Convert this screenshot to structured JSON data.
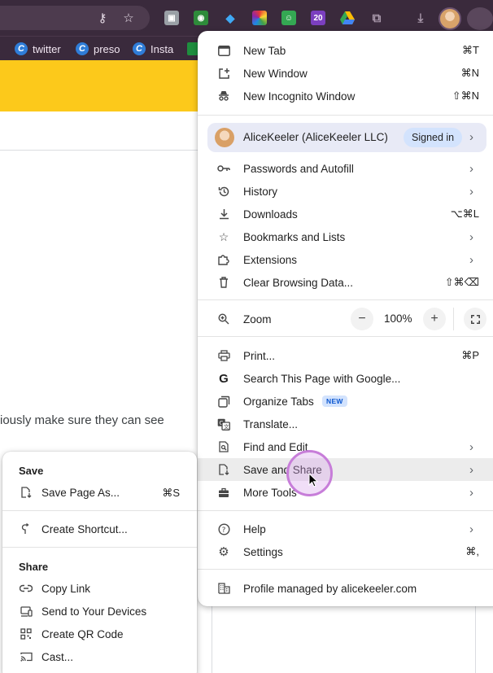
{
  "bookmarks": [
    {
      "label": "twitter",
      "icon": "c-logo-icon"
    },
    {
      "label": "preso",
      "icon": "c-logo-icon"
    },
    {
      "label": "Insta",
      "icon": "c-logo-icon"
    }
  ],
  "page": {
    "body_text": "iously make sure they can see"
  },
  "menu": {
    "new_tab": {
      "label": "New Tab",
      "shortcut": "⌘T"
    },
    "new_window": {
      "label": "New Window",
      "shortcut": "⌘N"
    },
    "incognito": {
      "label": "New Incognito Window",
      "shortcut": "⇧⌘N"
    },
    "profile": {
      "name": "AliceKeeler (AliceKeeler LLC)",
      "status": "Signed in"
    },
    "passwords": {
      "label": "Passwords and Autofill"
    },
    "history": {
      "label": "History"
    },
    "downloads": {
      "label": "Downloads",
      "shortcut": "⌥⌘L"
    },
    "bookmarks": {
      "label": "Bookmarks and Lists"
    },
    "extensions": {
      "label": "Extensions"
    },
    "clear_data": {
      "label": "Clear Browsing Data...",
      "shortcut": "⇧⌘⌫"
    },
    "zoom": {
      "label": "Zoom",
      "minus": "−",
      "value": "100%",
      "plus": "+"
    },
    "print": {
      "label": "Print...",
      "shortcut": "⌘P"
    },
    "search_page": {
      "label": "Search This Page with Google..."
    },
    "organize_tabs": {
      "label": "Organize Tabs",
      "badge": "NEW"
    },
    "translate": {
      "label": "Translate..."
    },
    "find_edit": {
      "label": "Find and Edit"
    },
    "save_share": {
      "label": "Save and Share"
    },
    "more_tools": {
      "label": "More Tools"
    },
    "help": {
      "label": "Help"
    },
    "settings": {
      "label": "Settings",
      "shortcut": "⌘,"
    },
    "managed": {
      "label": "Profile managed by alicekeeler.com"
    }
  },
  "submenu": {
    "save_heading": "Save",
    "save_page": {
      "label": "Save Page As...",
      "shortcut": "⌘S"
    },
    "create_shortcut": {
      "label": "Create Shortcut..."
    },
    "share_heading": "Share",
    "copy_link": {
      "label": "Copy Link"
    },
    "send_devices": {
      "label": "Send to Your Devices"
    },
    "qr_code": {
      "label": "Create QR Code"
    },
    "cast": {
      "label": "Cast..."
    }
  },
  "colors": {
    "chrome_bar": "#3a2a3c",
    "page_banner": "#fcc91b",
    "badge_bg": "#d3e3fd",
    "hover_bg": "#ececec",
    "cursor_ring": "#c77dd9"
  }
}
